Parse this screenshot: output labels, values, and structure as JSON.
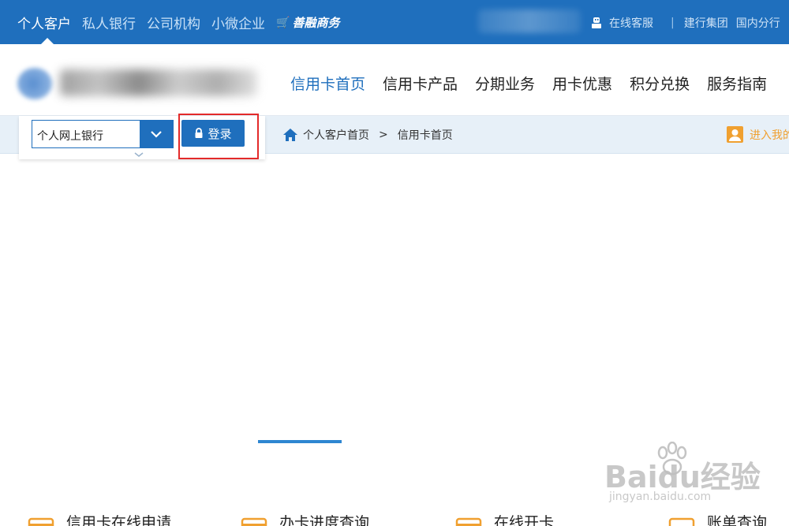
{
  "top_nav": {
    "items": [
      {
        "label": "个人客户",
        "active": true
      },
      {
        "label": "私人银行",
        "active": false
      },
      {
        "label": "公司机构",
        "active": false
      },
      {
        "label": "小微企业",
        "active": false
      }
    ],
    "brand_label": "善融商务",
    "right_links": [
      "在线客服",
      "建行集团",
      "国内分行"
    ],
    "colors": {
      "bar_bg": "#1f6fbd",
      "active_text": "#ffffff",
      "inactive_text": "#c9e1f7"
    }
  },
  "main_nav": {
    "items": [
      {
        "label": "信用卡首页",
        "active": true
      },
      {
        "label": "信用卡产品",
        "active": false
      },
      {
        "label": "分期业务",
        "active": false
      },
      {
        "label": "用卡优惠",
        "active": false
      },
      {
        "label": "积分兑换",
        "active": false
      },
      {
        "label": "服务指南",
        "active": false
      }
    ],
    "active_color": "#1f6fbd"
  },
  "login": {
    "channel_value": "个人网上银行",
    "button_label": "登录",
    "highlight_color": "#e32a2a"
  },
  "breadcrumb": {
    "items": [
      "个人客户首页",
      "信用卡首页"
    ],
    "separator": ">"
  },
  "enter_my_label": "进入我的",
  "quick_services": [
    {
      "label": "信用卡在线申请",
      "icon": "credit-card-apply-icon"
    },
    {
      "label": "办卡进度查询",
      "icon": "card-progress-icon"
    },
    {
      "label": "在线开卡",
      "icon": "card-activate-icon"
    },
    {
      "label": "账单查询",
      "icon": "bill-query-icon"
    }
  ],
  "watermark": {
    "brand": "Baidu经验",
    "url": "jingyan.baidu.com"
  }
}
